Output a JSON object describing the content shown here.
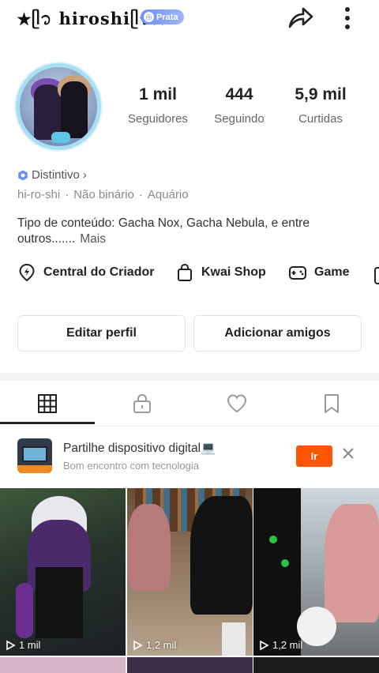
{
  "header": {
    "username": "★ᥫ᭡ hiroshiᥫ᭡☆",
    "badge_label": "Prata",
    "share_icon": "share-arrow-icon",
    "more_icon": "vertical-dots-icon"
  },
  "profile": {
    "stats": [
      {
        "value": "1 mil",
        "label": "Seguidores"
      },
      {
        "value": "444",
        "label": "Seguindo"
      },
      {
        "value": "5,9 mil",
        "label": "Curtidas"
      }
    ],
    "distintivo_label": "Distintivo",
    "distintivo_chevron": "›",
    "meta": [
      "hi-ro-shi",
      "Não binário",
      "Aquário"
    ],
    "meta_separator": "·",
    "bio": "Tipo de conteúdo: Gacha Nox, Gacha Nebula, e entre outros.......",
    "bio_more": "Mais"
  },
  "links": [
    {
      "label": "Central do Criador",
      "icon": "creator-bolt-icon"
    },
    {
      "label": "Kwai Shop",
      "icon": "shopping-bag-icon"
    },
    {
      "label": "Game",
      "icon": "gamepad-icon"
    }
  ],
  "buttons": {
    "edit": "Editar perfil",
    "add_friends": "Adicionar amigos"
  },
  "tabs": [
    {
      "name": "grid",
      "icon": "grid-icon",
      "active": true
    },
    {
      "name": "private",
      "icon": "lock-icon",
      "active": false
    },
    {
      "name": "liked",
      "icon": "heart-icon",
      "active": false
    },
    {
      "name": "saved",
      "icon": "bookmark-icon",
      "active": false
    }
  ],
  "ad": {
    "title": "Partilhe dispositivo digital💻",
    "subtitle": "Bom encontro com tecnologia",
    "cta": "Ir"
  },
  "videos": [
    {
      "views": "1 mil"
    },
    {
      "views": "1,2 mil"
    },
    {
      "views": "1,2 mil"
    }
  ],
  "colors": {
    "accent_orange": "#fe5500",
    "badge_blue": "#6d8ff5",
    "avatar_ring": "#a8dff2"
  }
}
